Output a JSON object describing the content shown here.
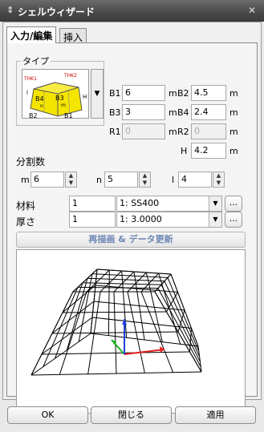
{
  "window": {
    "title": "シェルウィザード",
    "menu_icon": "⇕",
    "close_glyph": "✕"
  },
  "tabs": [
    {
      "label": "入力/編集",
      "active": true
    },
    {
      "label": "挿入",
      "active": false
    }
  ],
  "type_group": {
    "label": "タイプ",
    "diagram_labels": {
      "thk1": "THK1",
      "thk2": "THK2",
      "b4": "B4",
      "b3": "B3",
      "b2": "B2",
      "b1": "B1",
      "l": "l",
      "h": "H",
      "n": "n",
      "m": "m"
    }
  },
  "dims": {
    "b1": {
      "label": "B1",
      "value": "6",
      "unit": "m"
    },
    "b2": {
      "label": "B2",
      "value": "4.5",
      "unit": "m"
    },
    "b3": {
      "label": "B3",
      "value": "3",
      "unit": "m"
    },
    "b4": {
      "label": "B4",
      "value": "2.4",
      "unit": "m"
    },
    "r1": {
      "label": "R1",
      "value": "0",
      "unit": "m"
    },
    "r2": {
      "label": "R2",
      "value": "0",
      "unit": "m"
    },
    "h": {
      "label": "H",
      "value": "4.2",
      "unit": "m"
    }
  },
  "division": {
    "label": "分割数",
    "m": {
      "label": "m",
      "value": "6"
    },
    "n": {
      "label": "n",
      "value": "5"
    },
    "l": {
      "label": "l",
      "value": "4"
    }
  },
  "material": {
    "label": "材料",
    "id": "1",
    "selected": "1: SS400",
    "dots": "..."
  },
  "thickness": {
    "label": "厚さ",
    "id": "1",
    "selected": "1: 3.0000",
    "dots": "..."
  },
  "redraw_button": "再描画 & データ更新",
  "footer": {
    "ok": "OK",
    "close": "閉じる",
    "apply": "適用"
  },
  "colors": {
    "axis_x": "#e02020",
    "axis_y": "#20b020",
    "axis_z": "#2040e0",
    "diagram_fill": "#f5e400",
    "diagram_text": "#cc0000"
  }
}
